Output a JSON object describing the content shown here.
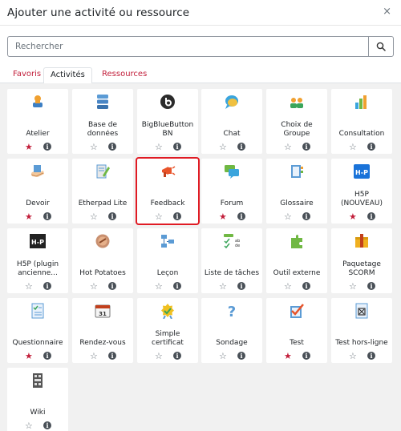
{
  "modal": {
    "title": "Ajouter une activité ou ressource",
    "close_glyph": "×"
  },
  "search": {
    "placeholder": "Rechercher"
  },
  "tabs": [
    {
      "label": "Favoris"
    },
    {
      "label": "Activités"
    },
    {
      "label": "Ressources"
    }
  ],
  "colors": {
    "accent": "#c21f3b",
    "highlight": "#e01b24",
    "grid_bg": "#f1f1f1"
  },
  "activities": [
    {
      "lines": [
        "Atelier"
      ],
      "favorite": true,
      "icon": "workshop-icon"
    },
    {
      "lines": [
        "Base de",
        "données"
      ],
      "favorite": false,
      "icon": "database-icon"
    },
    {
      "lines": [
        "BigBlueButton",
        "BN"
      ],
      "favorite": false,
      "icon": "bigbluebutton-icon"
    },
    {
      "lines": [
        "Chat"
      ],
      "favorite": false,
      "icon": "chat-icon"
    },
    {
      "lines": [
        "Choix de",
        "Groupe"
      ],
      "favorite": false,
      "icon": "group-choice-icon"
    },
    {
      "lines": [
        "Consultation"
      ],
      "favorite": false,
      "icon": "consultation-icon"
    },
    {
      "lines": [
        "Devoir"
      ],
      "favorite": true,
      "icon": "assignment-icon"
    },
    {
      "lines": [
        "Etherpad Lite"
      ],
      "favorite": false,
      "icon": "etherpad-icon"
    },
    {
      "lines": [
        "Feedback"
      ],
      "favorite": false,
      "icon": "feedback-icon",
      "highlighted": true
    },
    {
      "lines": [
        "Forum"
      ],
      "favorite": true,
      "icon": "forum-icon"
    },
    {
      "lines": [
        "Glossaire"
      ],
      "favorite": false,
      "icon": "glossary-icon"
    },
    {
      "lines": [
        "H5P",
        "(NOUVEAU)"
      ],
      "favorite": true,
      "icon": "h5p-icon"
    },
    {
      "lines": [
        "H5P (plugin",
        "ancienne..."
      ],
      "favorite": false,
      "icon": "h5p-legacy-icon"
    },
    {
      "lines": [
        "Hot Potatoes"
      ],
      "favorite": false,
      "icon": "hotpotatoes-icon"
    },
    {
      "lines": [
        "Leçon"
      ],
      "favorite": false,
      "icon": "lesson-icon"
    },
    {
      "lines": [
        "Liste de tâches"
      ],
      "favorite": false,
      "icon": "checklist-icon"
    },
    {
      "lines": [
        "Outil externe"
      ],
      "favorite": false,
      "icon": "external-tool-icon"
    },
    {
      "lines": [
        "Paquetage",
        "SCORM"
      ],
      "favorite": false,
      "icon": "scorm-icon"
    },
    {
      "lines": [
        "Questionnaire"
      ],
      "favorite": true,
      "icon": "questionnaire-icon"
    },
    {
      "lines": [
        "Rendez-vous"
      ],
      "favorite": false,
      "icon": "calendar-icon"
    },
    {
      "lines": [
        "Simple",
        "certificat"
      ],
      "favorite": false,
      "icon": "certificate-icon"
    },
    {
      "lines": [
        "Sondage"
      ],
      "favorite": false,
      "icon": "survey-icon"
    },
    {
      "lines": [
        "Test"
      ],
      "favorite": true,
      "icon": "quiz-icon"
    },
    {
      "lines": [
        "Test hors-ligne"
      ],
      "favorite": false,
      "icon": "offline-quiz-icon"
    },
    {
      "lines": [
        "Wiki"
      ],
      "favorite": false,
      "icon": "wiki-icon"
    }
  ]
}
